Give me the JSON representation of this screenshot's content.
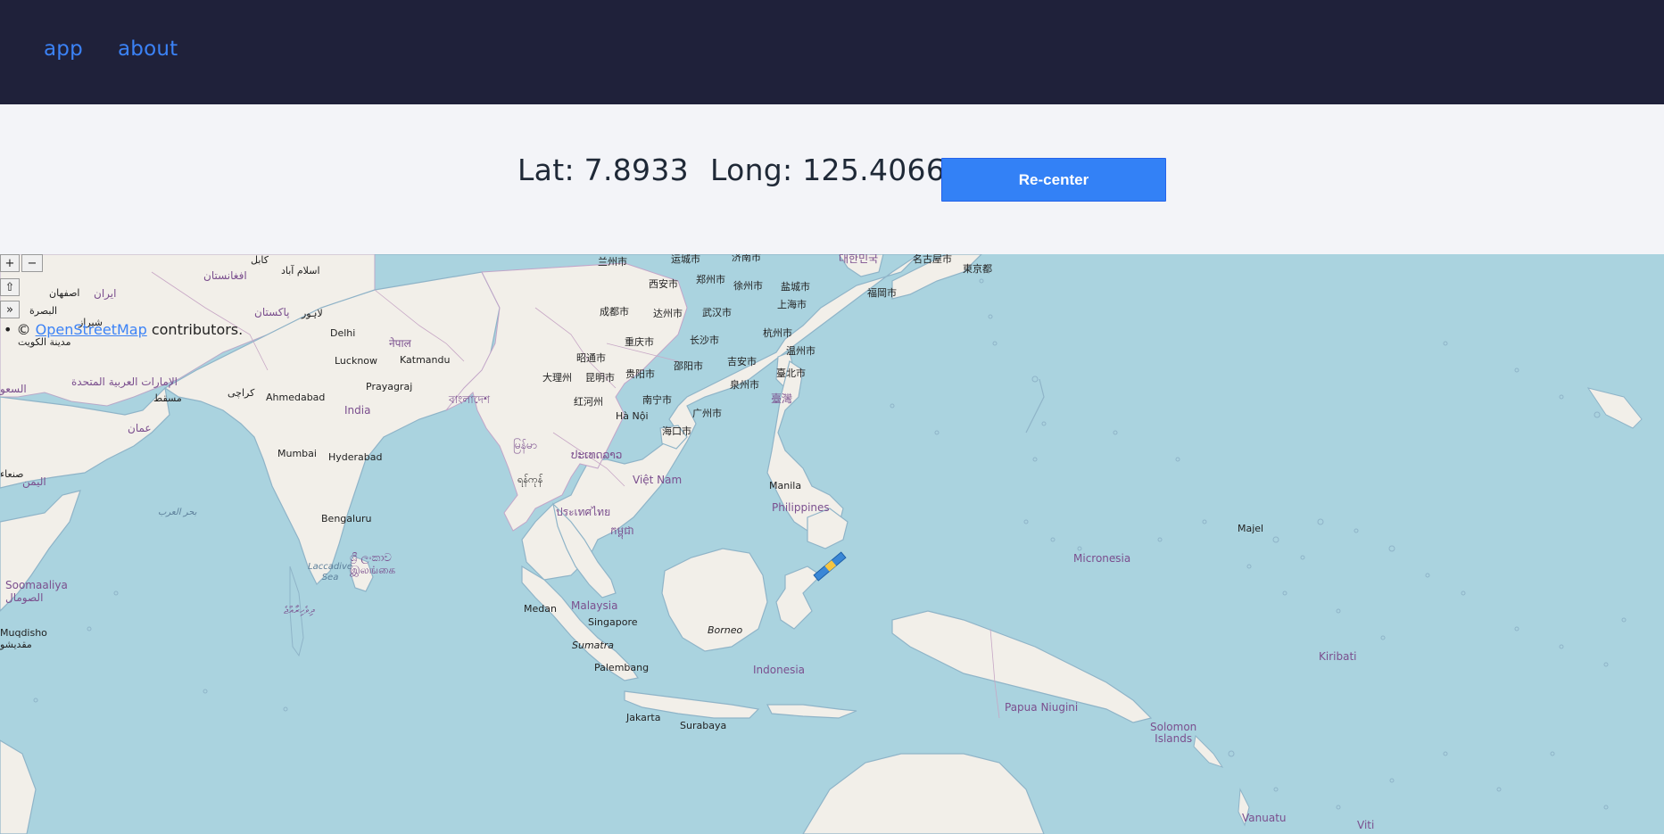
{
  "nav": {
    "app": "app",
    "about": "about"
  },
  "coords": {
    "lat_text": "Lat: 7.8933",
    "long_text": "Long: 125.4066"
  },
  "recenter_label": "Re-center",
  "map_controls": {
    "zoom_in": "+",
    "zoom_out": "−",
    "home": "⇧",
    "expand": "»"
  },
  "attribution": {
    "bullet": "•",
    "prefix": "©",
    "link": "OpenStreetMap",
    "suffix": "contributors."
  },
  "marker": {
    "lat": 7.8933,
    "long": 125.4066
  },
  "labels": {
    "lanzhou": "兰州市",
    "yuncheng": "运城市",
    "jinan": "济南市",
    "korea": "대한민국",
    "nagoya": "名古屋市",
    "tokyo": "東京都",
    "xian": "西安市",
    "zhengzhou": "郑州市",
    "xuzhou": "徐州市",
    "yancheng": "盐城市",
    "fukuoka": "福岡市",
    "chengdu": "成都市",
    "dazhou": "达州市",
    "wuhan": "武汉市",
    "shanghai": "上海市",
    "kabul": "کابل",
    "islamabad": "اسلام آباد",
    "afghanistan": "افغانستان",
    "iran": "ایران",
    "isfahan": "اصفهان",
    "lahore": "لاہور",
    "pakistan": "پاکستان",
    "basra": "البصرة",
    "shiraz": "شیراز",
    "kuwait": "مدينة الكويت",
    "delhi": "Delhi",
    "nepal": "नेपाल",
    "chongqing": "重庆市",
    "changsha": "长沙市",
    "hangzhou": "杭州市",
    "wenzhou": "温州市",
    "lucknow": "Lucknow",
    "kathmandu": "Katmandu",
    "zhaotong": "昭通市",
    "kunming": "昆明市",
    "guiyang": "贵阳市",
    "shaoyang": "邵阳市",
    "jian": "吉安市",
    "taipei": "臺北市",
    "dali": "大理州",
    "quanzhou": "泉州市",
    "uae": "الإمارات العربية المتحدة",
    "muscat": "مسقط",
    "karachi": "کراچی",
    "ahmedabad": "Ahmedabad",
    "prayagraj": "Prayagraj",
    "bangladesh": "বাংলাদেশ",
    "honghe": "红河州",
    "nanning": "南宁市",
    "guangzhou": "广州市",
    "taiwan": "臺灣",
    "saudi": "السعو",
    "india": "India",
    "hanoi": "Hà Nội",
    "haikou": "海口市",
    "oman": "عمان",
    "mumbai": "Mumbai",
    "hyderabad": "Hyderabad",
    "myanmar": "မြန်မာ",
    "laos": "ປະເທດລາວ",
    "yangon": "ရန်ကုန်",
    "vietnam": "Việt Nam",
    "yemen": "اليمن",
    "sanaa": "صنعاء",
    "manila": "Manila",
    "arabian_sea": "بحر العرب",
    "philippines": "Philippines",
    "thailand": "ประเทศไทย",
    "bengaluru": "Bengaluru",
    "cambodia": "កម្ពុជា",
    "majel": "Majel",
    "srilanka": "ශ්‍රී ලංකාව\nஇலங்கை",
    "laccadive": "Laccadive\nSea",
    "micronesia": "Micronesia",
    "somalia": "Soomaaliya\nالصومال",
    "maldives": "ދިވެހިރާއްޖެ",
    "medan": "Medan",
    "malaysia": "Malaysia",
    "singapore": "Singapore",
    "borneo": "Borneo",
    "mogadishu": "Muqdisho\nمقديشو",
    "sumatra": "Sumatra",
    "kiribati": "Kiribati",
    "palembang": "Palembang",
    "indonesia": "Indonesia",
    "png": "Papua Niugini",
    "solomon": "Solomon\nIslands",
    "jakarta": "Jakarta",
    "surabaya": "Surabaya",
    "vanuatu": "Vanuatu",
    "fiji": "Viti"
  }
}
